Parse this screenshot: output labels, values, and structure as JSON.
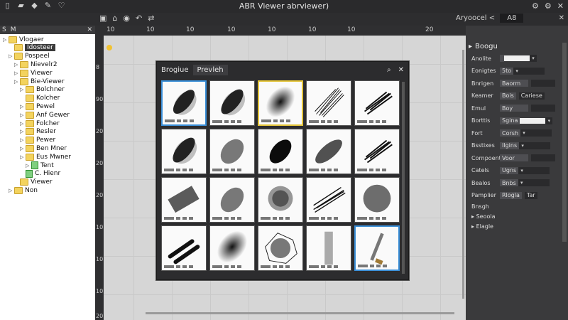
{
  "window": {
    "title": "ABR Viewer abrviewer)"
  },
  "toolbar": {
    "right_label": "Aryoocel <",
    "search_value": "A8"
  },
  "tree": {
    "header_tabs": [
      "S",
      "M"
    ],
    "items": [
      {
        "label": "Vlogaer",
        "depth": 0,
        "type": "folder",
        "arrow": "▷"
      },
      {
        "label": "Idosteer",
        "depth": 1,
        "type": "folder",
        "arrow": "",
        "selected": true
      },
      {
        "label": "Pospeel",
        "depth": 1,
        "type": "folder",
        "arrow": "▷"
      },
      {
        "label": "Nievelr2",
        "depth": 2,
        "type": "folder",
        "arrow": "▷"
      },
      {
        "label": "Viewer",
        "depth": 2,
        "type": "folder",
        "arrow": "▷"
      },
      {
        "label": "Bie-Viewer",
        "depth": 2,
        "type": "folder",
        "arrow": "▷"
      },
      {
        "label": "Bolchner",
        "depth": 3,
        "type": "folder",
        "arrow": "▷"
      },
      {
        "label": "Kolcher",
        "depth": 3,
        "type": "folder",
        "arrow": ""
      },
      {
        "label": "Pewel",
        "depth": 3,
        "type": "folder",
        "arrow": "▷"
      },
      {
        "label": "Anf Gewer",
        "depth": 3,
        "type": "folder",
        "arrow": "▷"
      },
      {
        "label": "Folcher",
        "depth": 3,
        "type": "folder",
        "arrow": "▷"
      },
      {
        "label": "Resler",
        "depth": 3,
        "type": "folder",
        "arrow": "▷"
      },
      {
        "label": "Pewer",
        "depth": 3,
        "type": "folder",
        "arrow": "▷"
      },
      {
        "label": "Ben Mner",
        "depth": 3,
        "type": "folder",
        "arrow": "▷"
      },
      {
        "label": "Eus Mwner",
        "depth": 3,
        "type": "folder",
        "arrow": "▷"
      },
      {
        "label": "Tent",
        "depth": 4,
        "type": "file",
        "arrow": "▷"
      },
      {
        "label": "C. Hienr",
        "depth": 3,
        "type": "file",
        "arrow": ""
      },
      {
        "label": "Viewer",
        "depth": 2,
        "type": "folder",
        "arrow": ""
      },
      {
        "label": "Non",
        "depth": 1,
        "type": "folder",
        "arrow": "▷"
      }
    ]
  },
  "ruler": {
    "top": [
      "10",
      "10",
      "10",
      "10",
      "10",
      "10",
      "10",
      "20"
    ],
    "left": [
      "8",
      "90",
      "20",
      "20",
      "20",
      "10",
      "10",
      "10",
      "20"
    ]
  },
  "preview": {
    "tabs": [
      "Brogiue",
      "Prevleh"
    ],
    "controls": [
      "search-icon",
      "close-icon"
    ],
    "brushes": [
      "stroke-dense",
      "stroke-dense",
      "blur-round",
      "stroke-scratch",
      "stroke-streak",
      "stroke-dense",
      "spray-soft",
      "spray-dense",
      "stroke-soft",
      "stroke-streak",
      "blur-rect",
      "spray-soft",
      "noise-round",
      "scratch-wide",
      "noise-dense",
      "double-stroke",
      "blur-round",
      "scribble",
      "soft-vertical",
      "brown-stroke"
    ],
    "selected_blue": [
      0,
      19
    ],
    "selected_yellow": [
      2
    ]
  },
  "props": {
    "section": "Boogu",
    "rows": [
      {
        "label": "Anolite",
        "value": "",
        "kind": "swatch"
      },
      {
        "label": "Eonigtes",
        "value": "5to",
        "kind": "dd"
      },
      {
        "label": "Bnrigen",
        "value": "Baorm",
        "kind": "text"
      },
      {
        "label": "Keamer",
        "value": "Bois",
        "kind": "tabs",
        "extra": "Cariese"
      },
      {
        "label": "Emul",
        "value": "Boy",
        "kind": "text"
      },
      {
        "label": "Borttis",
        "value": "Sgina",
        "kind": "swatch"
      },
      {
        "label": "Fort",
        "value": "Corsh",
        "kind": "dd"
      },
      {
        "label": "Bsstixes",
        "value": "Ilgins",
        "kind": "dd"
      },
      {
        "label": "Cornpoent",
        "value": "Voor",
        "kind": "text"
      },
      {
        "label": "Catels",
        "value": "Ugns",
        "kind": "dd"
      },
      {
        "label": "Bealos",
        "value": "Bnbs",
        "kind": "dd"
      },
      {
        "label": "Pamplier",
        "value": "Rlogla",
        "kind": "tabs",
        "extra": "Tar"
      }
    ],
    "sub": {
      "title": "Bnsgh",
      "items": [
        "Seoola",
        "Elagle"
      ]
    }
  },
  "colors": {
    "accent_blue": "#3b8fd8",
    "accent_yellow": "#e5c53a",
    "folder": "#f3d35e"
  }
}
